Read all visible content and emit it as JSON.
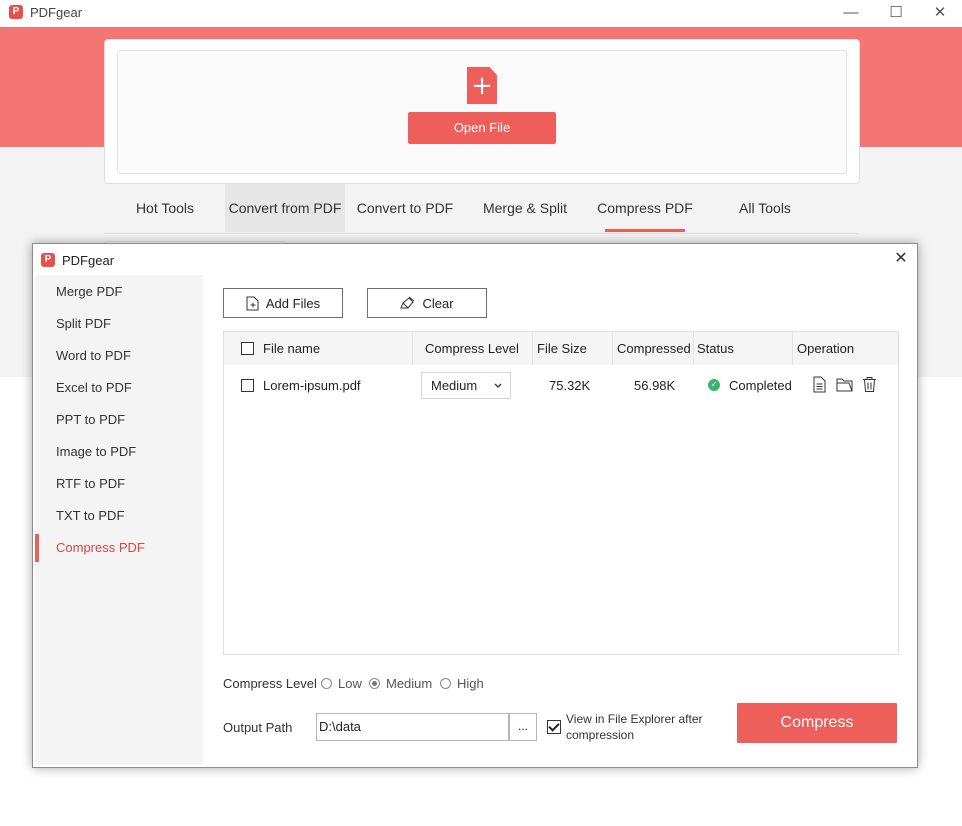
{
  "app": {
    "logo_letter": "P",
    "title": "PDFgear",
    "window_controls": {
      "minimize": "—",
      "maximize": "☐",
      "close": "✕"
    }
  },
  "home": {
    "open_file_label": "Open File",
    "tabs": [
      {
        "label": "Hot Tools"
      },
      {
        "label": "Convert from PDF"
      },
      {
        "label": "Convert to PDF"
      },
      {
        "label": "Merge & Split"
      },
      {
        "label": "Compress PDF"
      },
      {
        "label": "All Tools"
      }
    ]
  },
  "dialog": {
    "title": "PDFgear",
    "sidebar": [
      {
        "label": "Merge PDF"
      },
      {
        "label": "Split PDF"
      },
      {
        "label": "Word to PDF"
      },
      {
        "label": "Excel to PDF"
      },
      {
        "label": "PPT to PDF"
      },
      {
        "label": "Image to PDF"
      },
      {
        "label": "RTF to PDF"
      },
      {
        "label": "TXT to PDF"
      },
      {
        "label": "Compress PDF"
      }
    ],
    "toolbar": {
      "add_files": "Add Files",
      "clear": "Clear"
    },
    "table": {
      "headers": {
        "file_name": "File name",
        "compress_level": "Compress Level",
        "file_size": "File Size",
        "compressed_size": "Compressed S",
        "status": "Status",
        "operation": "Operation"
      },
      "rows": [
        {
          "file_name": "Lorem-ipsum.pdf",
          "compress_level": "Medium",
          "file_size": "75.32K",
          "compressed_size": "56.98K",
          "status": "Completed"
        }
      ]
    },
    "compress_level": {
      "label": "Compress Level",
      "options": [
        "Low",
        "Medium",
        "High"
      ],
      "selected": "Medium"
    },
    "output": {
      "label": "Output Path",
      "value": "D:\\data",
      "browse": "...",
      "view_in_explorer_line1": "View in File Explorer after",
      "view_in_explorer_line2": "compression",
      "view_in_explorer_checked": true
    },
    "compress_button": "Compress"
  },
  "colors": {
    "accent": "#ee5e5b",
    "banner": "#f47674",
    "success": "#3cb371"
  }
}
